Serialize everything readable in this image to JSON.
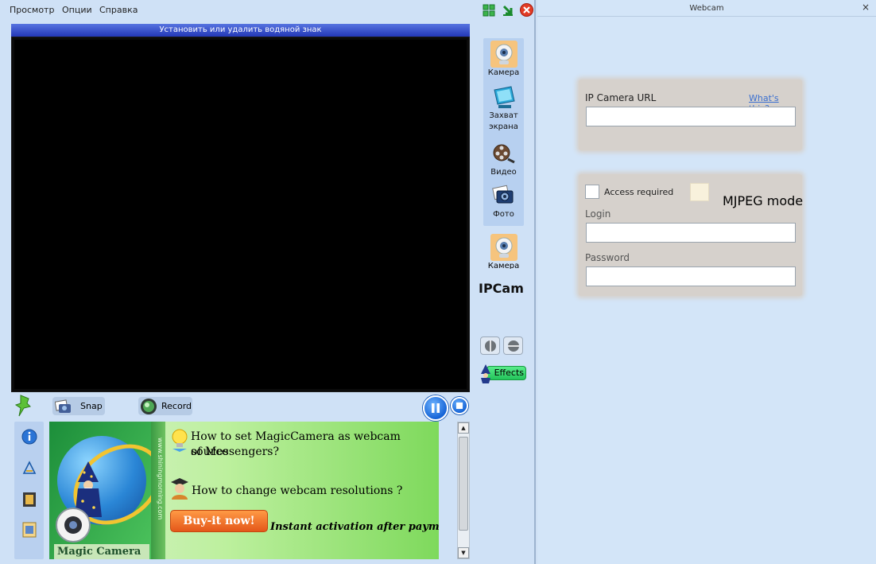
{
  "menu": {
    "items": [
      "Просмотр",
      "Опции",
      "Справка"
    ]
  },
  "watermark_bar": "Установить или удалить водяной знак",
  "side_panel": {
    "items": [
      {
        "label": "Камера",
        "icon": "webcam-icon"
      },
      {
        "label": "Захват экрана",
        "icon": "monitor-icon"
      },
      {
        "label": "Видео",
        "icon": "film-reel-icon"
      },
      {
        "label": "Фото",
        "icon": "photo-camera-icon"
      }
    ],
    "second_camera_label": "Камера",
    "ipcam_label": "IPCam",
    "effects_label": "Effects"
  },
  "toolbar": {
    "snap_label": "Snap",
    "record_label": "Record"
  },
  "ad": {
    "box_title": "Magic Camera",
    "box_side_text": "www.shiningmorning.com",
    "line1": "How to set MagicCamera as webcam source",
    "line1b": "of Messengers?",
    "line2": "How to change webcam resolutions ?",
    "buy_label": "Buy-it now!",
    "instant_label": "Instant activation after payment!"
  },
  "dialog": {
    "title": "Webcam",
    "close": "×",
    "ip_url_label": "IP Camera URL",
    "whats_this": "What's this?",
    "ip_url_value": "",
    "access_required_label": "Access required",
    "mjpeg_label": "MJPEG mode",
    "login_label": "Login",
    "login_value": "",
    "password_label": "Password",
    "password_value": ""
  }
}
